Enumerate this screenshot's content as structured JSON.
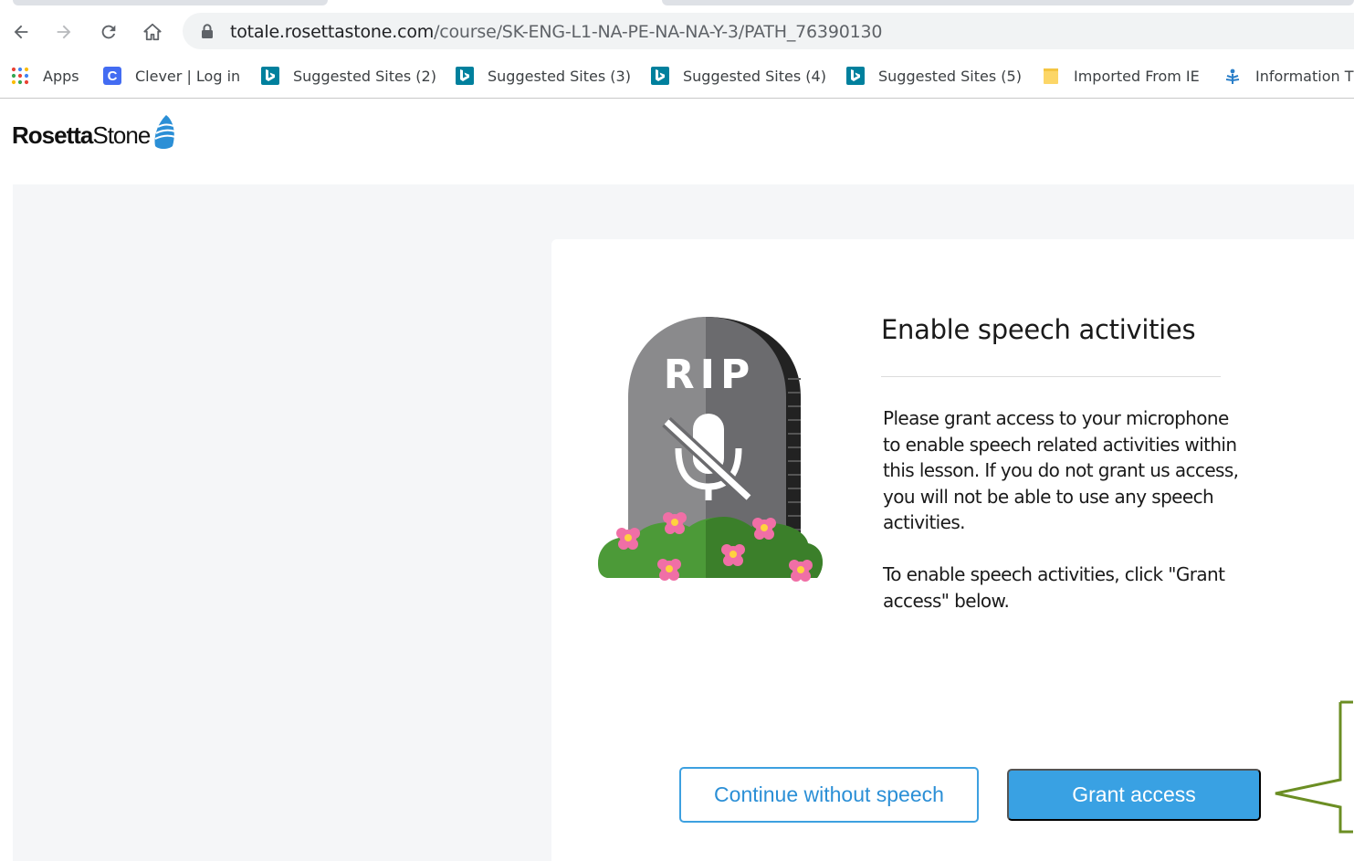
{
  "browser": {
    "url_host": "totale.rosettastone.com",
    "url_path": "/course/SK-ENG-L1-NA-PE-NA-NA-Y-3/PATH_76390130"
  },
  "bookmarks": [
    {
      "label": "Apps",
      "icon": "apps-grid-icon"
    },
    {
      "label": "Clever | Log in",
      "icon": "clever-icon",
      "icon_text": "C"
    },
    {
      "label": "Suggested Sites (2)",
      "icon": "bing-icon"
    },
    {
      "label": "Suggested Sites (3)",
      "icon": "bing-icon"
    },
    {
      "label": "Suggested Sites (4)",
      "icon": "bing-icon"
    },
    {
      "label": "Suggested Sites (5)",
      "icon": "bing-icon"
    },
    {
      "label": "Imported From IE",
      "icon": "folder-icon"
    },
    {
      "label": "Information T",
      "icon": "info-tech-icon"
    }
  ],
  "header": {
    "logo_bold": "Rosetta",
    "logo_light": "Stone"
  },
  "dialog": {
    "illustration": {
      "icon": "tombstone-muted-microphone-icon",
      "engraving": "RIP"
    },
    "title": "Enable speech activities",
    "paragraph_1": "Please grant access to your microphone to enable speech related activities within this lesson. If you do not grant us access, you will not be able to use any speech activities.",
    "paragraph_2": "To enable speech activities, click \"Grant access\" below.",
    "secondary_button": "Continue without speech",
    "primary_button": "Grant access"
  },
  "colors": {
    "primary": "#39a1e3",
    "outline_text": "#2b8fd6",
    "page_background": "#f5f6f8",
    "callout_stroke": "#6b8e23"
  }
}
